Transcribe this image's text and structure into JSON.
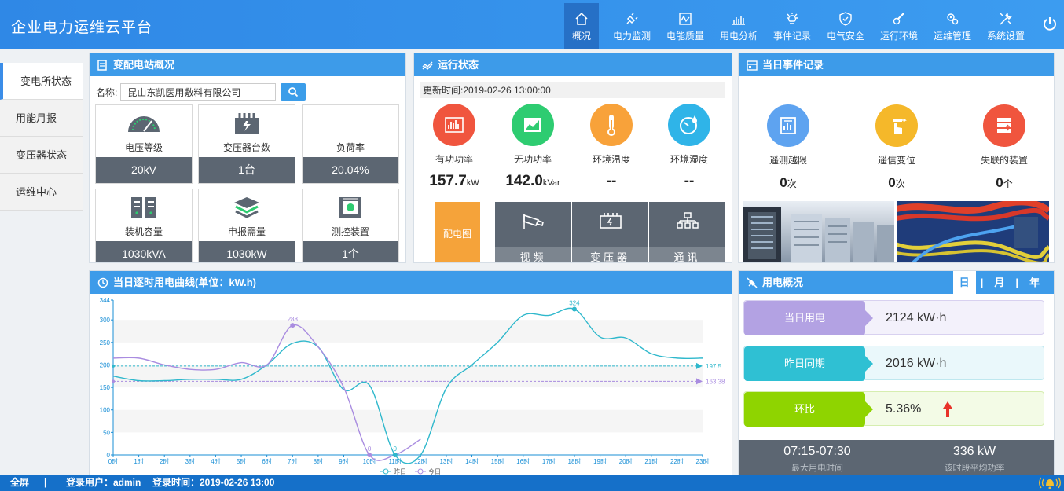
{
  "header": {
    "title": "企业电力运维云平台",
    "nav": [
      {
        "label": "概况",
        "icon": "home-icon",
        "active": true
      },
      {
        "label": "电力监测",
        "icon": "plug-icon"
      },
      {
        "label": "电能质量",
        "icon": "waveform-icon"
      },
      {
        "label": "用电分析",
        "icon": "bar-chart-icon"
      },
      {
        "label": "事件记录",
        "icon": "bulb-icon"
      },
      {
        "label": "电气安全",
        "icon": "shield-check-icon"
      },
      {
        "label": "运行环境",
        "icon": "thermometer-icon"
      },
      {
        "label": "运维管理",
        "icon": "gears-icon"
      },
      {
        "label": "系统设置",
        "icon": "wrench-icon"
      }
    ]
  },
  "sidebar": {
    "items": [
      {
        "label": "变电所状态",
        "active": true
      },
      {
        "label": "用能月报"
      },
      {
        "label": "变压器状态"
      },
      {
        "label": "运维中心"
      }
    ]
  },
  "station": {
    "title": "变配电站概况",
    "name_label": "名称:",
    "name_value": "昆山东凯医用敷料有限公司",
    "tiles": [
      {
        "label": "电压等级",
        "value": "20kV",
        "icon": "gauge-icon"
      },
      {
        "label": "变压器台数",
        "value": "1台",
        "icon": "transformer-icon"
      },
      {
        "label": "负荷率",
        "value": "20.04%",
        "icon": ""
      },
      {
        "label": "装机容量",
        "value": "1030kVA",
        "icon": "cabinet-icon"
      },
      {
        "label": "申报需量",
        "value": "1030kW",
        "icon": "layers-icon"
      },
      {
        "label": "测控装置",
        "value": "1个",
        "icon": "device-icon"
      }
    ]
  },
  "run_status": {
    "title": "运行状态",
    "update_time": "更新时间:2019-02-26 13:00:00",
    "metrics": [
      {
        "label": "有功功率",
        "value": "157.7",
        "unit": "kW",
        "color": "#f0553e",
        "icon": "active-power-icon"
      },
      {
        "label": "无功功率",
        "value": "142.0",
        "unit": "kVar",
        "color": "#2ecc71",
        "icon": "reactive-power-icon"
      },
      {
        "label": "环境温度",
        "value": "--",
        "unit": "",
        "color": "#f8a23a",
        "icon": "thermometer-icon"
      },
      {
        "label": "环境湿度",
        "value": "--",
        "unit": "",
        "color": "#2fb4e8",
        "icon": "humidity-icon"
      }
    ],
    "shortcut_label": "配电图",
    "shortcuts": [
      {
        "label": "视频",
        "icon": "camera-icon"
      },
      {
        "label": "变压器",
        "icon": "battery-icon"
      },
      {
        "label": "通讯",
        "icon": "network-icon"
      }
    ]
  },
  "events": {
    "title": "当日事件记录",
    "items": [
      {
        "label": "遥测越限",
        "value": "0",
        "unit": "次",
        "color": "#5ea3f0",
        "icon": "report-icon"
      },
      {
        "label": "遥信变位",
        "value": "0",
        "unit": "次",
        "color": "#f5b82a",
        "icon": "switch-icon"
      },
      {
        "label": "失联的装置",
        "value": "0",
        "unit": "个",
        "color": "#f0553e",
        "icon": "server-icon"
      }
    ]
  },
  "curve": {
    "title": "当日逐时用电曲线(单位：kW.h)",
    "legend": [
      "昨日",
      "今日"
    ]
  },
  "chart_data": {
    "type": "line",
    "title": "当日逐时用电曲线(单位：kW.h)",
    "categories": [
      "0时",
      "1时",
      "2时",
      "3时",
      "4时",
      "5时",
      "6时",
      "7时",
      "8时",
      "9时",
      "10时",
      "11时",
      "12时",
      "13时",
      "14时",
      "15时",
      "16时",
      "17时",
      "18时",
      "19时",
      "20时",
      "21时",
      "22时",
      "23时"
    ],
    "series": [
      {
        "name": "昨日",
        "color": "#2fb8cc",
        "values": [
          175,
          165,
          165,
          168,
          168,
          168,
          200,
          248,
          240,
          145,
          155,
          0,
          0,
          148,
          200,
          250,
          310,
          310,
          324,
          262,
          260,
          225,
          215,
          215
        ]
      },
      {
        "name": "今日",
        "color": "#a98ce0",
        "values": [
          215,
          215,
          200,
          190,
          190,
          205,
          200,
          288,
          240,
          150,
          0,
          0,
          35
        ]
      }
    ],
    "ylim": [
      0,
      344
    ],
    "yticks": [
      0,
      50,
      100,
      150,
      200,
      250,
      300,
      344
    ],
    "marklines": [
      {
        "value": 197.5,
        "color": "#2fb8cc"
      },
      {
        "value": 163.38,
        "color": "#a98ce0"
      }
    ],
    "labels": [
      {
        "series": "今日",
        "index": 7,
        "text": "288"
      },
      {
        "series": "今日",
        "index": 10,
        "text": "0"
      },
      {
        "series": "昨日",
        "index": 11,
        "text": "0"
      },
      {
        "series": "昨日",
        "index": 18,
        "text": "324"
      }
    ]
  },
  "usage": {
    "title": "用电概况",
    "tabs": [
      "日",
      "月",
      "年"
    ],
    "active_tab": "日",
    "rows": [
      {
        "label": "当日用电",
        "value": "2124 kW·h",
        "color": "#b3a2e3",
        "bg": "#f3f1fb"
      },
      {
        "label": "昨日同期",
        "value": "2016 kW·h",
        "color": "#2fc0d3",
        "bg": "#eaf8fb"
      },
      {
        "label": "环比",
        "value": "5.36%",
        "color": "#8fd400",
        "bg": "#f3fbe6"
      }
    ],
    "peak_time": "07:15-07:30",
    "peak_time_label": "最大用电时间",
    "avg_power": "336 kW",
    "avg_power_label": "该时段平均功率"
  },
  "footer": {
    "fullscreen": "全屏",
    "separator": "|",
    "user": "登录用户：admin",
    "login_time": "登录时间：2019-02-26 13:00"
  }
}
